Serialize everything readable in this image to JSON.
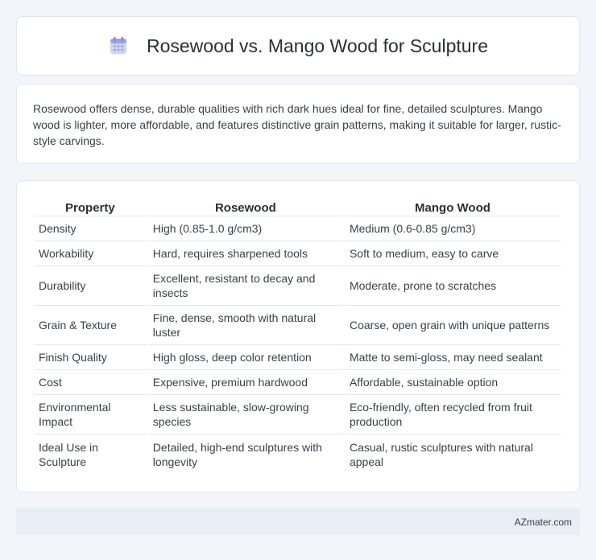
{
  "header": {
    "title": "Rosewood vs. Mango Wood for Sculpture",
    "icon": "calendar-icon"
  },
  "intro": {
    "text": "Rosewood offers dense, durable qualities with rich dark hues ideal for fine, detailed sculptures. Mango wood is lighter, more affordable, and features distinctive grain patterns, making it suitable for larger, rustic-style carvings."
  },
  "table": {
    "headers": [
      "Property",
      "Rosewood",
      "Mango Wood"
    ],
    "rows": [
      [
        "Density",
        "High (0.85-1.0 g/cm3)",
        "Medium (0.6-0.85 g/cm3)"
      ],
      [
        "Workability",
        "Hard, requires sharpened tools",
        "Soft to medium, easy to carve"
      ],
      [
        "Durability",
        "Excellent, resistant to decay and insects",
        "Moderate, prone to scratches"
      ],
      [
        "Grain & Texture",
        "Fine, dense, smooth with natural luster",
        "Coarse, open grain with unique patterns"
      ],
      [
        "Finish Quality",
        "High gloss, deep color retention",
        "Matte to semi-gloss, may need sealant"
      ],
      [
        "Cost",
        "Expensive, premium hardwood",
        "Affordable, sustainable option"
      ],
      [
        "Environmental Impact",
        "Less sustainable, slow-growing species",
        "Eco-friendly, often recycled from fruit production"
      ],
      [
        "Ideal Use in Sculpture",
        "Detailed, high-end sculptures with longevity",
        "Casual, rustic sculptures with natural appeal"
      ]
    ]
  },
  "footer": {
    "text": "AZmater.com"
  }
}
